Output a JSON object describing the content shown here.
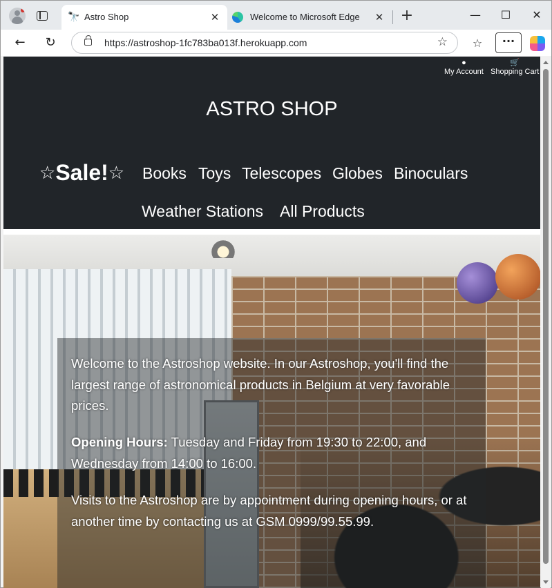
{
  "browser": {
    "tabs": [
      {
        "title": "Astro Shop",
        "favicon": "telescope-icon",
        "active": true
      },
      {
        "title": "Welcome to Microsoft Edge",
        "favicon": "edge-logo-icon",
        "active": false
      }
    ],
    "url": "https://astroshop-1fc783ba013f.herokuapp.com",
    "window_controls": {
      "minimize": "—",
      "maximize": "☐",
      "close": "✕"
    }
  },
  "site": {
    "title": "ASTRO SHOP",
    "header_links": {
      "account": "My Account",
      "cart": "Shopping Cart"
    },
    "nav": {
      "sale": "Sale!",
      "items": [
        "Books",
        "Toys",
        "Telescopes",
        "Globes",
        "Binoculars",
        "Weather Stations",
        "All Products"
      ]
    },
    "colors": {
      "header_bg": "#212529",
      "text": "#ffffff"
    }
  },
  "hero": {
    "welcome": "Welcome to the Astroshop website. In our Astroshop, you'll find the largest range of astronomical products in Belgium at very favorable prices.",
    "hours_label": "Opening Hours:",
    "hours_text": " Tuesday and Friday from 19:30 to 22:00, and Wednesday from 14:00 to 16:00.",
    "visits": "Visits to the Astroshop are by appointment during opening hours, or at another time by contacting us at GSM 0999/99.55.99."
  }
}
